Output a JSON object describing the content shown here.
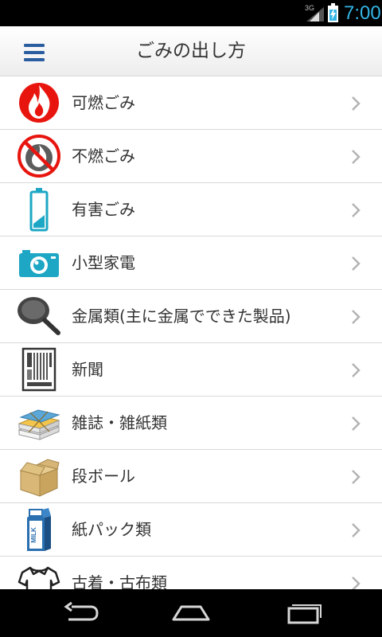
{
  "status_bar": {
    "network": "3G",
    "time": "7:00",
    "accent_color": "#33b5e5"
  },
  "app_bar": {
    "title": "ごみの出し方",
    "menu_icon": "hamburger-menu-icon",
    "accent_color": "#2a5d9f"
  },
  "items": [
    {
      "label": "可燃ごみ",
      "icon": "fire-icon"
    },
    {
      "label": "不燃ごみ",
      "icon": "no-fire-icon"
    },
    {
      "label": "有害ごみ",
      "icon": "battery-icon"
    },
    {
      "label": "小型家電",
      "icon": "camera-icon"
    },
    {
      "label": "金属類(主に金属でできた製品)",
      "icon": "frying-pan-icon"
    },
    {
      "label": "新聞",
      "icon": "newspaper-icon"
    },
    {
      "label": "雑誌・雑紙類",
      "icon": "magazine-bundle-icon"
    },
    {
      "label": "段ボール",
      "icon": "cardboard-box-icon"
    },
    {
      "label": "紙パック類",
      "icon": "milk-carton-icon"
    },
    {
      "label": "古着・古布類",
      "icon": "shirt-icon"
    }
  ],
  "nav_bar": {
    "buttons": [
      "back-icon",
      "home-icon",
      "recent-apps-icon"
    ]
  }
}
